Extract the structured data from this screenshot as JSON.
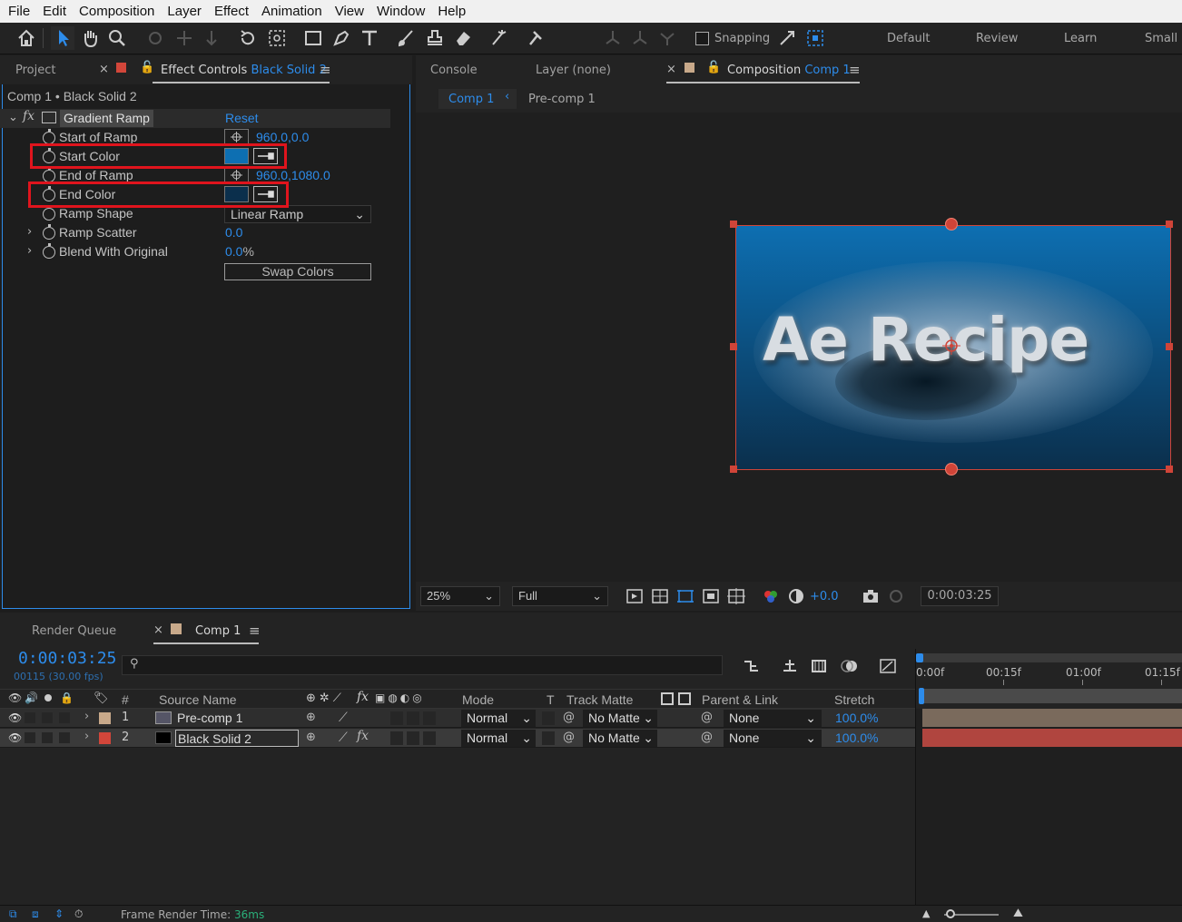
{
  "menu": [
    "File",
    "Edit",
    "Composition",
    "Layer",
    "Effect",
    "Animation",
    "View",
    "Window",
    "Help"
  ],
  "toolbar": {
    "snapping_label": "Snapping",
    "workspaces": [
      "Default",
      "Review",
      "Learn",
      "Small S"
    ]
  },
  "effect_controls": {
    "project_tab": "Project",
    "tab_label": "Effect Controls",
    "tab_layer": "Black Solid 2",
    "breadcrumb": "Comp 1 • Black Solid 2",
    "effect_name": "Gradient Ramp",
    "reset_label": "Reset",
    "fx_label": "fx",
    "properties": {
      "start_of_ramp": {
        "label": "Start of Ramp",
        "value": "960.0,0.0"
      },
      "start_color": {
        "label": "Start Color",
        "color": "#0d6fb2"
      },
      "end_of_ramp": {
        "label": "End of Ramp",
        "value": "960.0,1080.0"
      },
      "end_color": {
        "label": "End Color",
        "color": "#0b2f4c"
      },
      "ramp_shape": {
        "label": "Ramp Shape",
        "value": "Linear Ramp"
      },
      "ramp_scatter": {
        "label": "Ramp Scatter",
        "value": "0.0"
      },
      "blend_with_original": {
        "label": "Blend With Original",
        "value": "0.0",
        "unit": "%"
      }
    },
    "swap_colors_label": "Swap Colors"
  },
  "viewer": {
    "console_tab": "Console",
    "layer_tab": "Layer (none)",
    "composition_tab": "Composition",
    "composition_name": "Comp 1",
    "breadcrumbs": [
      "Comp 1",
      "Pre-comp 1"
    ],
    "title_text": "Ae Recipe",
    "zoom": "25%",
    "resolution": "Full",
    "exposure": "+0.0",
    "timecode": "0:00:03:25"
  },
  "timeline": {
    "render_queue_tab": "Render Queue",
    "comp_tab": "Comp 1",
    "timecode": "0:00:03:25",
    "frame_info": "00115 (30.00 fps)",
    "columns": {
      "num": "#",
      "source": "Source Name",
      "mode": "Mode",
      "t": "T",
      "track_matte": "Track Matte",
      "parent": "Parent & Link",
      "stretch": "Stretch"
    },
    "ruler": [
      "0:00f",
      "00:15f",
      "01:00f",
      "01:15f"
    ],
    "layers": [
      {
        "num": "1",
        "name": "Pre-comp 1",
        "mode": "Normal",
        "matte": "No Matte",
        "parent": "None",
        "stretch": "100.0%",
        "label_color": "#c8a98a",
        "bar_color": "#7a6a5c"
      },
      {
        "num": "2",
        "name": "Black Solid 2",
        "mode": "Normal",
        "matte": "No Matte",
        "parent": "None",
        "stretch": "100.0%",
        "label_color": "#d2463a",
        "bar_color": "#b0453f"
      }
    ],
    "frame_render_label": "Frame Render Time:",
    "frame_render_value": "36ms"
  }
}
